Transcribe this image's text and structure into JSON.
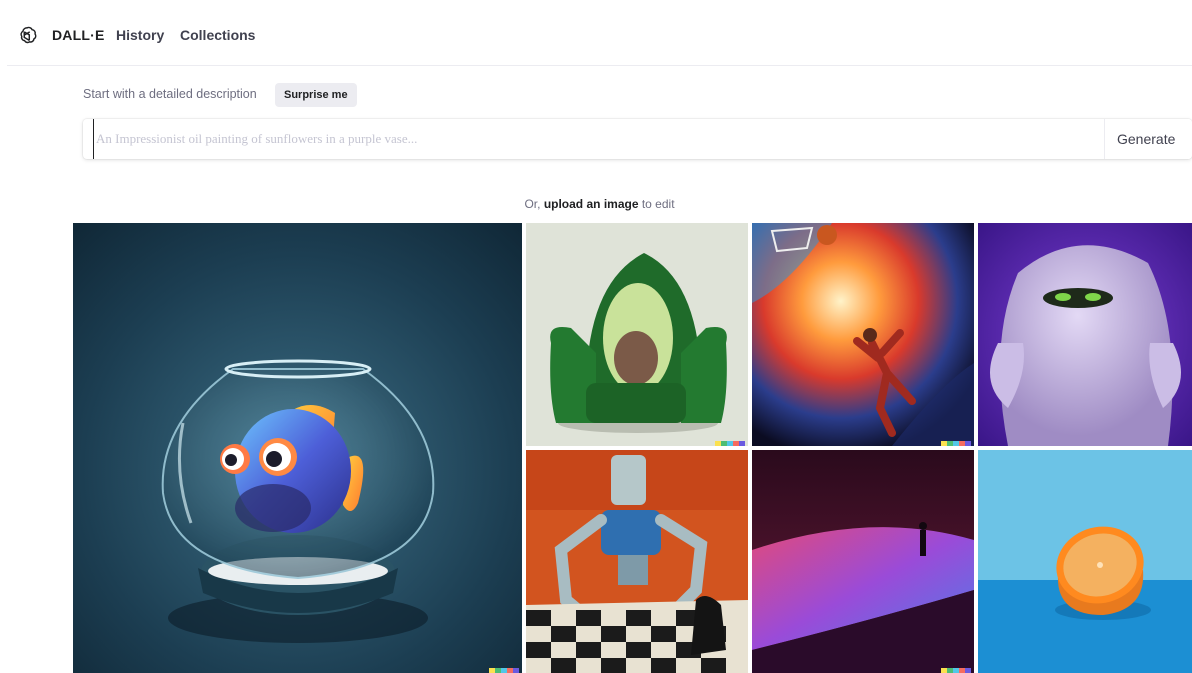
{
  "nav": {
    "brand": "DALL·E",
    "history": "History",
    "collections": "Collections"
  },
  "prompt": {
    "label": "Start with a detailed description",
    "surprise_label": "Surprise me",
    "placeholder": "An Impressionist oil painting of sunflowers in a purple vase...",
    "value": "",
    "generate_label": "Generate"
  },
  "upload": {
    "prefix": "Or, ",
    "link": "upload an image",
    "suffix": " to edit"
  },
  "gallery": {
    "images": [
      {
        "name": "fish-in-bowl-image"
      },
      {
        "name": "avocado-armchair-image"
      },
      {
        "name": "space-basketball-image"
      },
      {
        "name": "purple-monster-image"
      },
      {
        "name": "robot-chess-image"
      },
      {
        "name": "desert-silhouette-image"
      },
      {
        "name": "orange-half-image"
      }
    ],
    "badge_colors": [
      "#fbe14f",
      "#4dbd74",
      "#52c7e8",
      "#f56b5f",
      "#6a5ae0"
    ]
  },
  "colors": {
    "accent": "#10a37f",
    "text": "#202123",
    "muted": "#6e6e80"
  }
}
